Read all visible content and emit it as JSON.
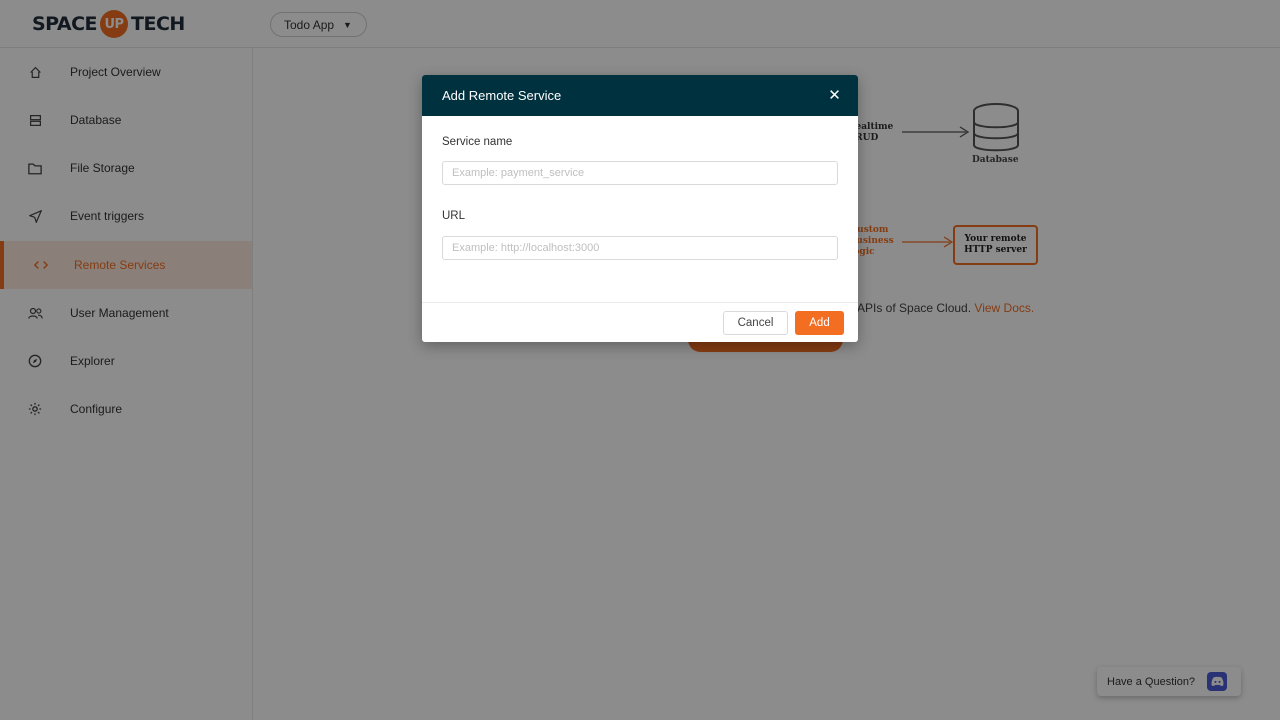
{
  "brand": {
    "left": "SPACE",
    "circle": "UP",
    "right": "TECH",
    "accent": "#f36e21",
    "dark": "#00313e"
  },
  "project": {
    "name": "Todo App",
    "caret_icon": "caret-down-icon"
  },
  "sidebar": {
    "items": [
      {
        "label": "Project Overview",
        "icon": "home-icon"
      },
      {
        "label": "Database",
        "icon": "database-icon"
      },
      {
        "label": "File Storage",
        "icon": "folder-icon"
      },
      {
        "label": "Event triggers",
        "icon": "send-icon"
      },
      {
        "label": "Remote Services",
        "icon": "code-icon",
        "active": true
      },
      {
        "label": "User Management",
        "icon": "users-icon"
      },
      {
        "label": "Explorer",
        "icon": "compass-icon"
      },
      {
        "label": "Configure",
        "icon": "gear-icon"
      }
    ]
  },
  "background": {
    "diagram": {
      "crud_label": "Realtime\nCRUD",
      "database_label": "Database",
      "custom_label": "Custom\nbusiness\nlogic",
      "server_label": "Your remote\nHTTP server"
    },
    "description_text": "APIs of Space Cloud.",
    "description_link": "View Docs."
  },
  "modal": {
    "title": "Add Remote Service",
    "close_icon": "close-icon",
    "service_name_label": "Service name",
    "service_name_placeholder": "Example: payment_service",
    "service_name_value": "",
    "url_label": "URL",
    "url_placeholder": "Example: http://localhost:3000",
    "url_value": "",
    "cancel_label": "Cancel",
    "add_label": "Add"
  },
  "help": {
    "label": "Have a Question?",
    "icon": "discord-icon"
  }
}
